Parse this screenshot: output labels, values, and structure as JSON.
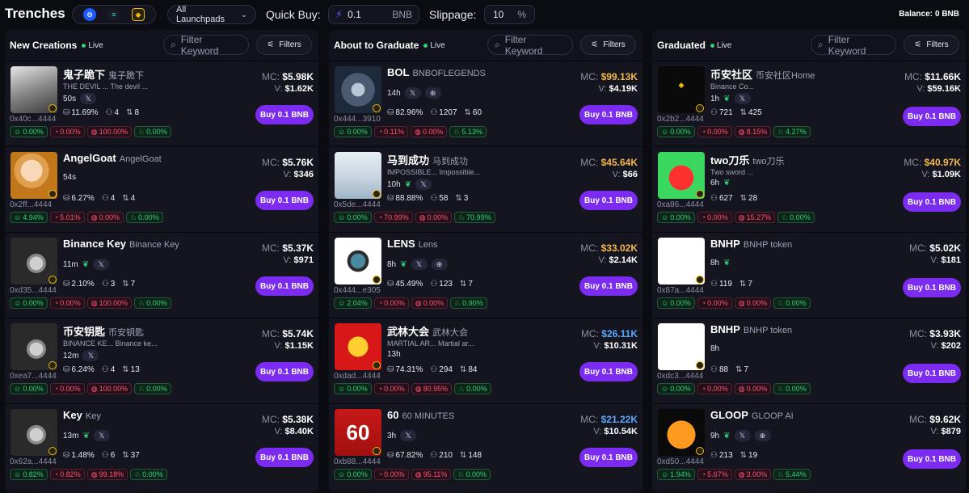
{
  "topbar": {
    "brand": "Trenches",
    "launchpad": "All Launchpads",
    "quick_buy_label": "Quick Buy:",
    "quick_buy_value": "0.1",
    "quick_buy_unit": "BNB",
    "slippage_label": "Slippage:",
    "slippage_value": "10",
    "slippage_unit": "%",
    "balance_label": "Balance:",
    "balance_value": "0 BNB"
  },
  "colors": {
    "accent": "#7b2cf0",
    "green": "#2fd07a",
    "red": "#ff5370",
    "gold": "#f5b84a",
    "blue": "#5aa8ff",
    "bnb": "#f0b90b"
  },
  "buy_label": "Buy 0.1 BNB",
  "filter_placeholder": "Filter Keyword",
  "filters_label": "Filters",
  "live_label": "Live",
  "columns": [
    {
      "title": "New Creations",
      "cards": [
        {
          "name": "鬼子跪下",
          "full": "鬼子跪下",
          "desc": "THE DEVIL ... The devil ...",
          "age": "50s",
          "addr": "0x40c...4444",
          "holders": "11.69%",
          "s2": "4",
          "s3": "8",
          "chips": [
            "0.00%",
            "0.00%",
            "100.00%",
            "0.00%"
          ],
          "mc": "$5.98K",
          "vol": "$1.62K"
        },
        {
          "name": "AngelGoat",
          "full": "AngelGoat",
          "desc": "",
          "age": "54s",
          "addr": "0x2ff...4444",
          "holders": "6.27%",
          "s2": "4",
          "s3": "4",
          "chips": [
            "4.94%",
            "5.01%",
            "0.00%",
            "0.00%"
          ],
          "mc": "$5.76K",
          "vol": "$346"
        },
        {
          "name": "Binance Key",
          "full": "Binance Key",
          "desc": "",
          "age": "11m",
          "addr": "0xd35...4444",
          "holders": "2.10%",
          "s2": "3",
          "s3": "7",
          "chips": [
            "0.00%",
            "0.00%",
            "100.00%",
            "0.00%"
          ],
          "mc": "$5.37K",
          "vol": "$971"
        },
        {
          "name": "币安钥匙",
          "full": "币安钥匙",
          "desc": "BINANCE KE... Binance ke...",
          "age": "12m",
          "addr": "0xea7...4444",
          "holders": "6.24%",
          "s2": "4",
          "s3": "13",
          "chips": [
            "0.00%",
            "0.00%",
            "100.00%",
            "0.00%"
          ],
          "mc": "$5.74K",
          "vol": "$1.15K"
        },
        {
          "name": "Key",
          "full": "Key",
          "desc": "",
          "age": "13m",
          "addr": "0x62a...4444",
          "holders": "1.48%",
          "s2": "6",
          "s3": "37",
          "chips": [
            "0.82%",
            "0.82%",
            "99.18%",
            "0.00%"
          ],
          "mc": "$5.38K",
          "vol": "$8.40K"
        }
      ]
    },
    {
      "title": "About to Graduate",
      "cards": [
        {
          "name": "BOL",
          "full": "BNBOFLEGENDS",
          "desc": "",
          "age": "14h",
          "addr": "0x444...3910",
          "holders": "82.96%",
          "s2": "1207",
          "s3": "60",
          "chips": [
            "0.00%",
            "0.11%",
            "0.00%",
            "5.13%"
          ],
          "mc": "$99.13K",
          "vol": "$4.19K"
        },
        {
          "name": "马到成功",
          "full": "马到成功",
          "desc": "IMPOSSIBLE... Impossible...",
          "age": "10h",
          "addr": "0x5de...4444",
          "holders": "88.88%",
          "s2": "58",
          "s3": "3",
          "chips": [
            "0.00%",
            "70.99%",
            "0.00%",
            "70.99%"
          ],
          "mc": "$45.64K",
          "vol": "$66"
        },
        {
          "name": "LENS",
          "full": "Lens",
          "desc": "",
          "age": "8h",
          "addr": "0x444...e305",
          "holders": "45.49%",
          "s2": "123",
          "s3": "7",
          "chips": [
            "2.04%",
            "0.00%",
            "0.00%",
            "0.90%"
          ],
          "mc": "$33.02K",
          "vol": "$2.14K"
        },
        {
          "name": "武林大会",
          "full": "武林大会",
          "desc": "MARTIAL AR... Martial ar...",
          "age": "13h",
          "addr": "0xdad...4444",
          "holders": "74.31%",
          "s2": "294",
          "s3": "84",
          "chips": [
            "0.00%",
            "0.00%",
            "80.95%",
            "0.00%"
          ],
          "mc": "$26.11K",
          "vol": "$10.31K"
        },
        {
          "name": "60",
          "full": "60 MINUTES",
          "desc": "",
          "age": "3h",
          "addr": "0xb88...4444",
          "holders": "67.82%",
          "s2": "210",
          "s3": "148",
          "chips": [
            "0.00%",
            "0.00%",
            "95.11%",
            "0.00%"
          ],
          "mc": "$21.22K",
          "vol": "$10.54K"
        }
      ]
    },
    {
      "title": "Graduated",
      "cards": [
        {
          "name": "币安社区",
          "full": "币安社区Home",
          "desc": "Binance Co...",
          "age": "1h",
          "addr": "0x2b2...4444",
          "holders": "721",
          "s3": "425",
          "chips": [
            "0.00%",
            "0.00%",
            "8.15%",
            "4.27%"
          ],
          "mc": "$11.66K",
          "vol": "$59.16K"
        },
        {
          "name": "two刀乐",
          "full": "two刀乐",
          "desc": "Two sword ...",
          "age": "6h",
          "addr": "0xa86...4444",
          "holders": "627",
          "s3": "28",
          "chips": [
            "0.00%",
            "0.00%",
            "15.27%",
            "0.00%"
          ],
          "mc": "$40.97K",
          "vol": "$1.09K"
        },
        {
          "name": "BNHP",
          "full": "BNHP token",
          "desc": "",
          "age": "8h",
          "addr": "0x87a...4444",
          "holders": "119",
          "s3": "7",
          "chips": [
            "0.00%",
            "0.00%",
            "0.00%",
            "0.00%"
          ],
          "mc": "$5.02K",
          "vol": "$181"
        },
        {
          "name": "BNHP",
          "full": "BNHP token",
          "desc": "",
          "age": "8h",
          "addr": "0xdc3...4444",
          "holders": "88",
          "s3": "7",
          "chips": [
            "0.00%",
            "0.00%",
            "0.00%",
            "0.00%"
          ],
          "mc": "$3.93K",
          "vol": "$202"
        },
        {
          "name": "GLOOP",
          "full": "GLOOP AI",
          "desc": "",
          "age": "9h",
          "addr": "0xd50...4444",
          "holders": "213",
          "s3": "19",
          "chips": [
            "1.94%",
            "5.67%",
            "3.00%",
            "5.44%"
          ],
          "mc": "$9.62K",
          "vol": "$879"
        }
      ]
    }
  ]
}
